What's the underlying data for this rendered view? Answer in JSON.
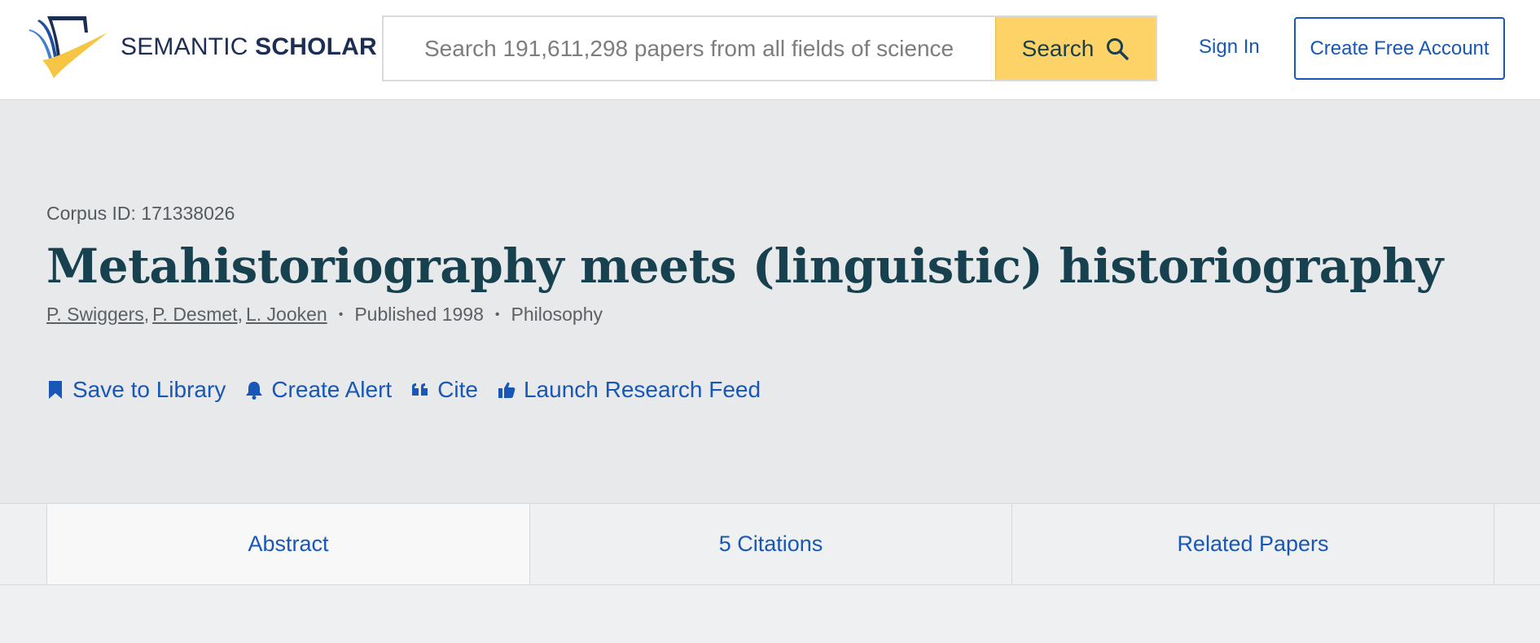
{
  "brand": {
    "name_light": "SEMANTIC",
    "name_bold": "SCHOLAR",
    "logo_icon": "semantic-scholar-logo",
    "colors": {
      "navy": "#1d2e55",
      "yellow": "#fdd266",
      "link_blue": "#1857b6",
      "title": "#17414f"
    }
  },
  "search": {
    "placeholder": "Search 191,611,298 papers from all fields of science",
    "button_label": "Search",
    "button_icon": "search-icon"
  },
  "auth": {
    "sign_in": "Sign In",
    "create_account": "Create Free Account"
  },
  "paper": {
    "corpus_id": "Corpus ID: 171338026",
    "title": "Metahistoriography meets (linguistic) historiography",
    "authors": [
      "P. Swiggers",
      "P. Desmet",
      "L. Jooken"
    ],
    "published": "Published 1998",
    "field": "Philosophy"
  },
  "actions": [
    {
      "label": "Save to Library",
      "icon": "bookmark-icon"
    },
    {
      "label": "Create Alert",
      "icon": "bell-icon"
    },
    {
      "label": "Cite",
      "icon": "quote-icon"
    },
    {
      "label": "Launch Research Feed",
      "icon": "thumbs-up-icon"
    }
  ],
  "tabs": [
    {
      "label": "Abstract",
      "active": true
    },
    {
      "label": "5 Citations",
      "active": false
    },
    {
      "label": "Related Papers",
      "active": false
    }
  ]
}
